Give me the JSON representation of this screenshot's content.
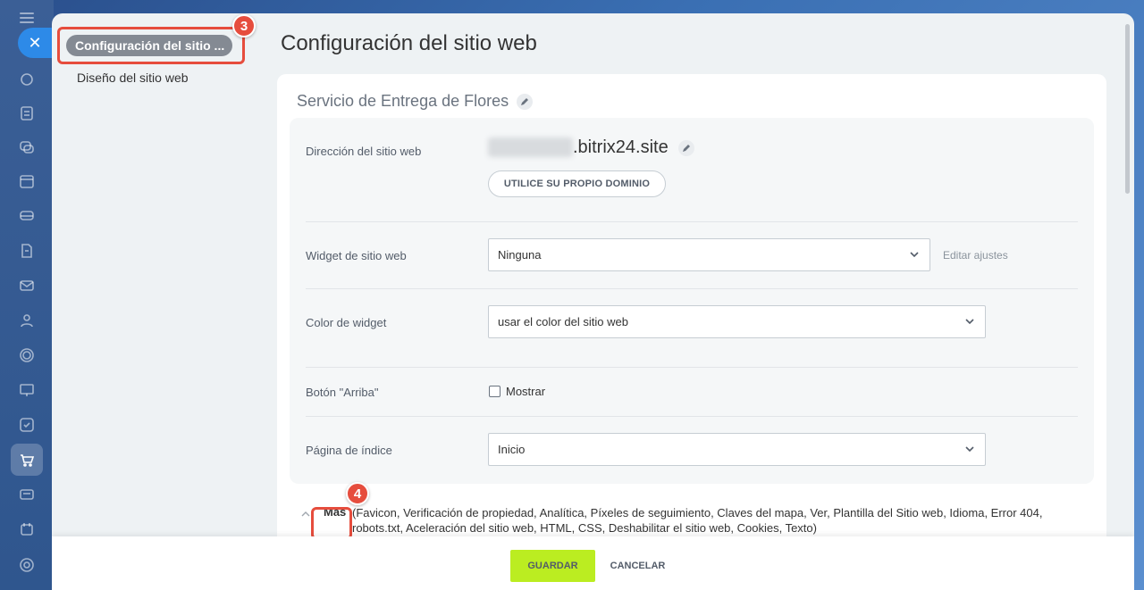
{
  "nav": {
    "active_item": "Configuración del sitio ...",
    "second_item": "Diseño del sitio web"
  },
  "badges": {
    "step3": "3",
    "step4": "4"
  },
  "page": {
    "title": "Configuración del sitio web"
  },
  "site": {
    "name": "Servicio de Entrega de Flores"
  },
  "fields": {
    "address_label": "Dirección del sitio web",
    "address_value": ".bitrix24.site",
    "own_domain_button": "UTILICE SU PROPIO DOMINIO",
    "widget_label": "Widget de sitio web",
    "widget_value": "Ninguna",
    "widget_edit_link": "Editar ajustes",
    "widget_color_label": "Color de widget",
    "widget_color_value": "usar el color del sitio web",
    "top_button_label": "Botón \"Arriba\"",
    "top_button_checkbox": "Mostrar",
    "index_page_label": "Página de índice",
    "index_page_value": "Inicio"
  },
  "more": {
    "label": "Más",
    "items": "(Favicon,  Verificación de propiedad,  Analítica,  Píxeles de seguimiento,  Claves del mapa,  Ver,  Plantilla del Sitio web,  Idioma,  Error 404,  robots.txt,  Aceleración del sitio web,  HTML,  CSS,  Deshabilitar el sitio web,  Cookies,  Texto)"
  },
  "footer": {
    "save": "GUARDAR",
    "cancel": "CANCELAR"
  },
  "icons": {
    "rail": [
      "menu-icon",
      "close-icon",
      "feed-icon",
      "tasks-icon",
      "chat-icon",
      "calendar-icon",
      "drive-icon",
      "docs-icon",
      "mail-icon",
      "contacts-icon",
      "crm-icon",
      "sites-icon",
      "checklist-icon",
      "shop-icon",
      "contact-center-icon",
      "automation-icon",
      "settings-icon"
    ]
  },
  "colors": {
    "highlight": "#e64d3d",
    "save_button": "#bbed21",
    "close_button": "#2d8ae8"
  }
}
